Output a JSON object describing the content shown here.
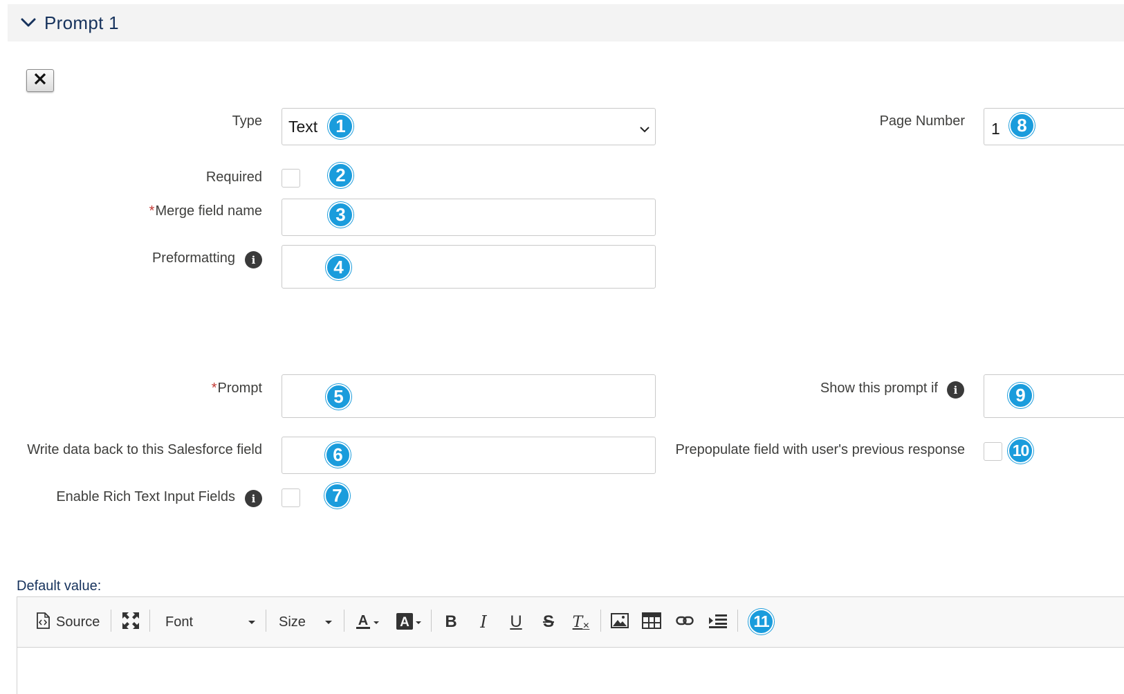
{
  "section": {
    "title": "Prompt 1",
    "expanded": true
  },
  "close_button": {
    "icon": "close-icon"
  },
  "fields": {
    "type": {
      "label": "Type",
      "value": "Text"
    },
    "required": {
      "label": "Required",
      "checked": false
    },
    "merge_field_name": {
      "required_marker": "*",
      "label": "Merge field name",
      "value": ""
    },
    "preformatting": {
      "label": "Preformatting",
      "value": ""
    },
    "prompt": {
      "required_marker": "*",
      "label": "Prompt",
      "value": ""
    },
    "write_back": {
      "label": "Write data back to this Salesforce field",
      "value": ""
    },
    "enable_rich_text": {
      "label": "Enable Rich Text Input Fields",
      "checked": false
    },
    "page_number": {
      "label": "Page Number",
      "value": "1"
    },
    "show_prompt_if": {
      "label": "Show this prompt if",
      "value": ""
    },
    "prepopulate": {
      "label": "Prepopulate field with user's previous response",
      "checked": false
    }
  },
  "badges": [
    "1",
    "2",
    "3",
    "4",
    "5",
    "6",
    "7",
    "8",
    "9",
    "10",
    "11"
  ],
  "default_value": {
    "label": "Default value:",
    "toolbar": {
      "source_label": "Source",
      "font_label": "Font",
      "size_label": "Size",
      "bold_glyph": "B",
      "italic_glyph": "I",
      "underline_glyph": "U",
      "strike_glyph": "S",
      "clear_format_glyph": "T"
    }
  },
  "colors": {
    "badge": "#1a9cdc",
    "header_bg": "#f3f3f3",
    "title": "#16325c",
    "required_marker": "#c23934"
  }
}
